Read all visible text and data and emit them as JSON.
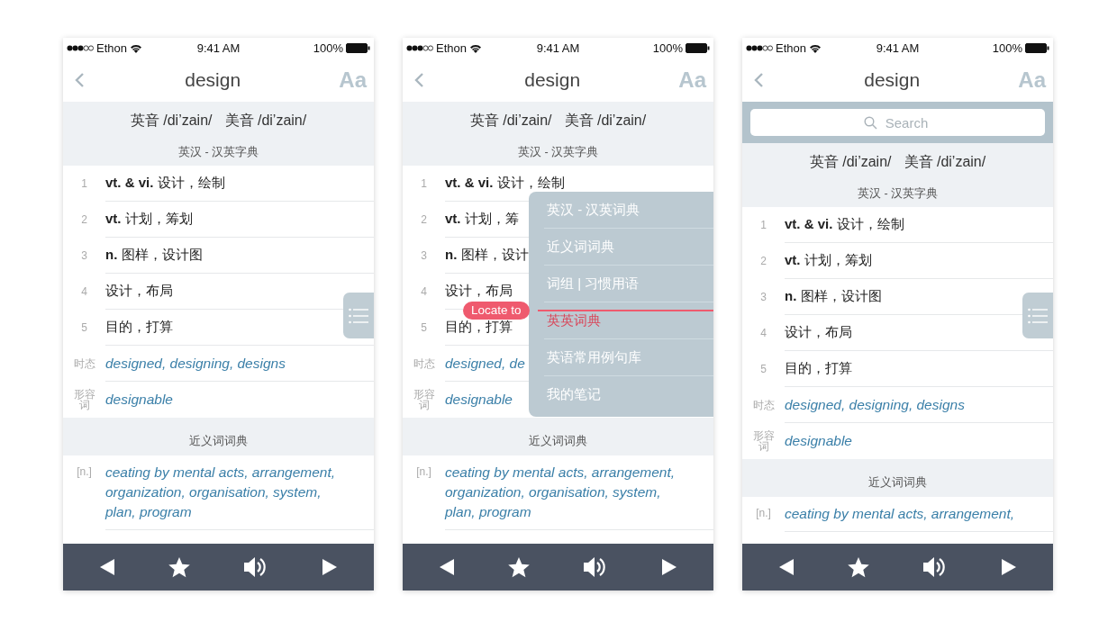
{
  "screens": [
    {
      "status": {
        "carrier": "Ethon",
        "time": "9:41 AM",
        "battery": "100%"
      },
      "nav": {
        "title": "design",
        "font_button": "Aa"
      },
      "phonetics": [
        "英音 /di’zain/",
        "美音 /di’zain/"
      ],
      "dictionary_title": "英汉 - 汉英字典",
      "entries": [
        {
          "kind": "sense",
          "label": "1",
          "text": "**vt. & vi.** 设计，绘制"
        },
        {
          "kind": "sense",
          "label": "2",
          "text": "**vt.** 计划，筹划"
        },
        {
          "kind": "sense",
          "label": "3",
          "text": "**n.** 图样，设计图"
        },
        {
          "kind": "sense",
          "label": "4",
          "text": "设计，布局"
        },
        {
          "kind": "sense",
          "label": "5",
          "text": "目的，打算"
        },
        {
          "kind": "form",
          "label": "时态",
          "text": "designed, designing, designs"
        },
        {
          "kind": "form",
          "label": "形容词",
          "text": "designable"
        }
      ],
      "synonyms_title": "近义词词典",
      "synonyms": [
        {
          "label": "[n.]",
          "text": "ceating by mental acts, arrangement, organization, organisation, system, plan, program"
        }
      ],
      "index_button": true
    },
    {
      "status": {
        "carrier": "Ethon",
        "time": "9:41 AM",
        "battery": "100%"
      },
      "nav": {
        "title": "design",
        "font_button": "Aa"
      },
      "phonetics": [
        "英音 /di’zain/",
        "美音 /di’zain/"
      ],
      "dictionary_title": "英汉 - 汉英字典",
      "entries": [
        {
          "kind": "sense",
          "label": "1",
          "text": "**vt. & vi.** 设计，绘制"
        },
        {
          "kind": "sense",
          "label": "2",
          "text": "**vt.** 计划，筹"
        },
        {
          "kind": "sense",
          "label": "3",
          "text": "**n.** 图样，设计"
        },
        {
          "kind": "sense",
          "label": "4",
          "text": "设计，布局"
        },
        {
          "kind": "sense",
          "label": "5",
          "text": "目的，打算"
        },
        {
          "kind": "form",
          "label": "时态",
          "text": "designed, de"
        },
        {
          "kind": "form",
          "label": "形容词",
          "text": "designable"
        }
      ],
      "synonyms_title": "近义词词典",
      "synonyms": [
        {
          "label": "[n.]",
          "text": "ceating by mental acts, arrangement, organization, organisation, system, plan, program"
        }
      ],
      "index_button": false,
      "menu": {
        "locate_label": "Locate to",
        "items": [
          {
            "label": "英汉 - 汉英词典",
            "selected": false
          },
          {
            "label": "近义词词典",
            "selected": false
          },
          {
            "label": "词组 | 习惯用语",
            "selected": false
          },
          {
            "label": "英英词典",
            "selected": true
          },
          {
            "label": "英语常用例句库",
            "selected": false
          },
          {
            "label": "我的笔记",
            "selected": false
          }
        ]
      }
    },
    {
      "status": {
        "carrier": "Ethon",
        "time": "9:41 AM",
        "battery": "100%"
      },
      "nav": {
        "title": "design",
        "font_button": "Aa"
      },
      "search": {
        "placeholder": "Search"
      },
      "phonetics": [
        "英音 /di’zain/",
        "美音 /di’zain/"
      ],
      "dictionary_title": "英汉 - 汉英字典",
      "entries": [
        {
          "kind": "sense",
          "label": "1",
          "text": "**vt. & vi.** 设计，绘制"
        },
        {
          "kind": "sense",
          "label": "2",
          "text": "**vt.** 计划，筹划"
        },
        {
          "kind": "sense",
          "label": "3",
          "text": "**n.** 图样，设计图"
        },
        {
          "kind": "sense",
          "label": "4",
          "text": "设计，布局"
        },
        {
          "kind": "sense",
          "label": "5",
          "text": "目的，打算"
        },
        {
          "kind": "form",
          "label": "时态",
          "text": "designed, designing, designs"
        },
        {
          "kind": "form",
          "label": "形容词",
          "text": "designable"
        }
      ],
      "synonyms_title": "近义词词典",
      "synonyms": [
        {
          "label": "[n.]",
          "text": "ceating by mental acts, arrangement,"
        }
      ],
      "index_button": true
    }
  ]
}
